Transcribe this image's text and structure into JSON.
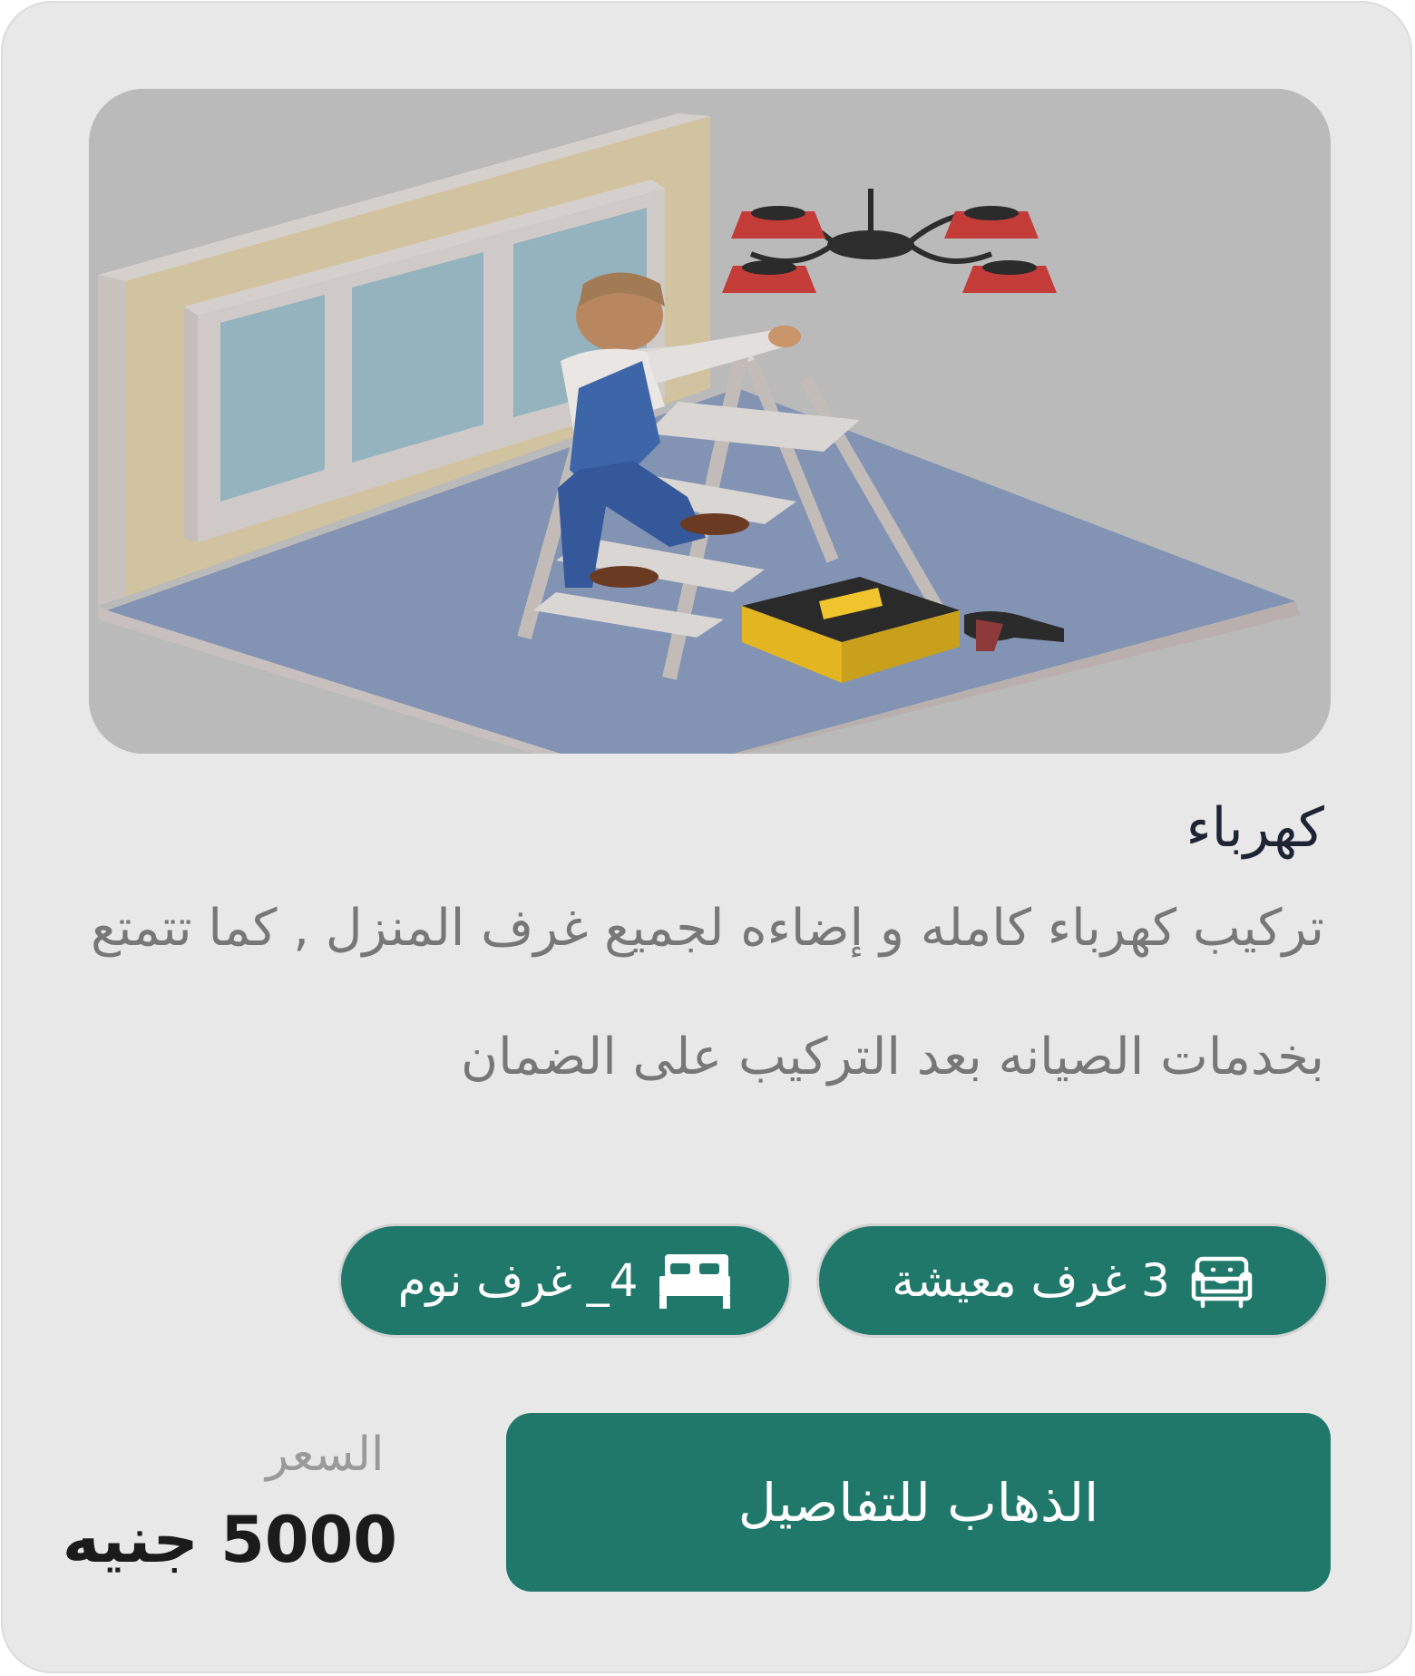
{
  "service": {
    "title": "كهرباء",
    "description": "تركيب كهرباء كامله و إضاءه لجميع غرف المنزل , كما تتمتع بخدمات الصيانه بعد التركيب على الضمان"
  },
  "features": [
    {
      "label": "3 غرف معيشة",
      "icon": "sofa-icon"
    },
    {
      "label": "4_ غرف نوم",
      "icon": "bed-icon"
    }
  ],
  "price": {
    "label": "السعر",
    "value": "5000 جنيه"
  },
  "actions": {
    "details_label": "الذهاب للتفاصيل"
  },
  "colors": {
    "accent": "#20786a",
    "card_background": "#e8e8e8",
    "title_text": "#1d2433",
    "muted_text": "#777777"
  }
}
